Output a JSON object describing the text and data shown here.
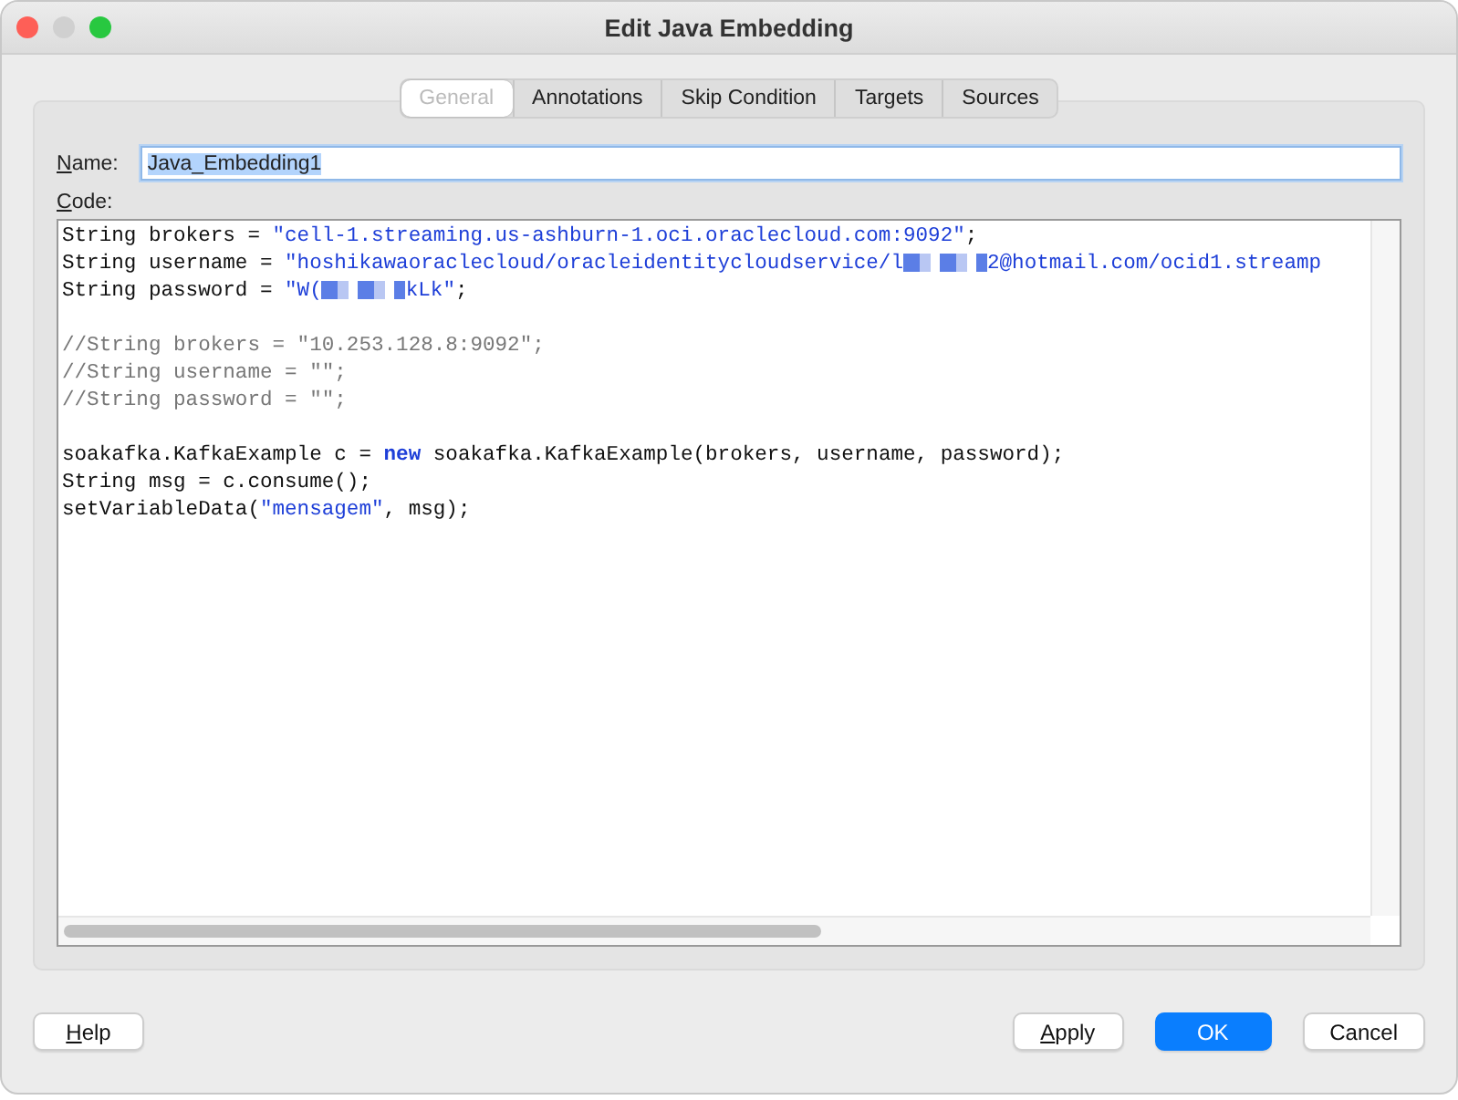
{
  "window": {
    "title": "Edit Java Embedding"
  },
  "tabs": [
    {
      "label": "General",
      "selected": true
    },
    {
      "label": "Annotations",
      "selected": false
    },
    {
      "label": "Skip Condition",
      "selected": false
    },
    {
      "label": "Targets",
      "selected": false
    },
    {
      "label": "Sources",
      "selected": false
    }
  ],
  "name_field": {
    "label": "Name:",
    "mnemonic": true,
    "value": "Java_Embedding1",
    "text_selected": true
  },
  "code_label": {
    "label": "Code:",
    "mnemonic": true
  },
  "code_blocks": [
    [
      [
        {
          "kind": "plain",
          "text": "String brokers = "
        },
        {
          "kind": "string",
          "text": "\"cell-1.streaming.us-ashburn-1.oci.oraclecloud.com:9092\""
        },
        {
          "kind": "plain",
          "text": ";"
        }
      ],
      [
        {
          "kind": "plain",
          "text": "String username = "
        },
        {
          "kind": "string",
          "text": "\"hoshikawaoraclecloud/oracleidentitycloudservice/l"
        },
        {
          "kind": "redacted"
        },
        {
          "kind": "string",
          "text": "2@hotmail.com/ocid1.streamp"
        }
      ],
      [
        {
          "kind": "plain",
          "text": "String password = "
        },
        {
          "kind": "string",
          "text": "\"W("
        },
        {
          "kind": "redacted"
        },
        {
          "kind": "string",
          "text": "kLk\""
        },
        {
          "kind": "plain",
          "text": ";"
        }
      ]
    ],
    [
      [
        {
          "kind": "comment",
          "text": "//String brokers = \"10.253.128.8:9092\";"
        }
      ],
      [
        {
          "kind": "comment",
          "text": "//String username = \"\";"
        }
      ],
      [
        {
          "kind": "comment",
          "text": "//String password = \"\";"
        }
      ]
    ],
    [
      [
        {
          "kind": "plain",
          "text": "soakafka.KafkaExample c = "
        },
        {
          "kind": "keyword",
          "text": "new"
        },
        {
          "kind": "plain",
          "text": " soakafka.KafkaExample(brokers, username, password);"
        }
      ],
      [
        {
          "kind": "plain",
          "text": "String msg = c.consume();"
        }
      ],
      [
        {
          "kind": "plain",
          "text": "setVariableData("
        },
        {
          "kind": "string",
          "text": "\"mensagem\""
        },
        {
          "kind": "plain",
          "text": ", msg);"
        }
      ]
    ]
  ],
  "buttons_left": [
    {
      "label": "Help",
      "mnemonic": true,
      "primary": false
    }
  ],
  "buttons_right": [
    {
      "label": "Apply",
      "mnemonic": true,
      "primary": false
    },
    {
      "label": "OK",
      "mnemonic": false,
      "primary": true
    },
    {
      "label": "Cancel",
      "mnemonic": false,
      "primary": false
    }
  ]
}
